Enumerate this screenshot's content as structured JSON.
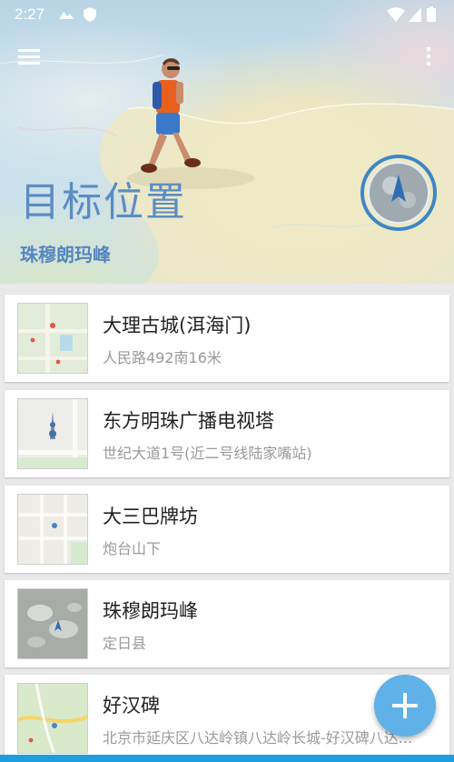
{
  "status_bar": {
    "time": "2:27",
    "icons": [
      "assistant-arrow-icon",
      "shield-icon",
      "wifi-icon",
      "signal-icon",
      "battery-icon"
    ]
  },
  "toolbar": {
    "menu_icon": "hamburger-menu-icon",
    "more_icon": "more-vert-icon"
  },
  "header": {
    "title": "目标位置",
    "subtitle": "珠穆朗玛峰",
    "compass_icon": "compass-map-icon",
    "title_color": "#5b8dc4"
  },
  "places": [
    {
      "name": "大理古城(洱海门)",
      "address": "人民路492南16米",
      "thumb": "green-map-thumbnail"
    },
    {
      "name": "东方明珠广播电视塔",
      "address": "世纪大道1号(近二号线陆家嘴站)",
      "thumb": "tower-map-thumbnail"
    },
    {
      "name": "大三巴牌坊",
      "address": "炮台山下",
      "thumb": "street-map-thumbnail"
    },
    {
      "name": "珠穆朗玛峰",
      "address": "定日县",
      "thumb": "mountain-map-thumbnail"
    },
    {
      "name": "好汉碑",
      "address": "北京市延庆区八达岭镇八达岭长城-好汉碑八达...",
      "thumb": "park-map-thumbnail"
    }
  ],
  "fab": {
    "icon": "plus-icon",
    "color": "#5fb1e8"
  },
  "accent_color": "#1e9fdc"
}
